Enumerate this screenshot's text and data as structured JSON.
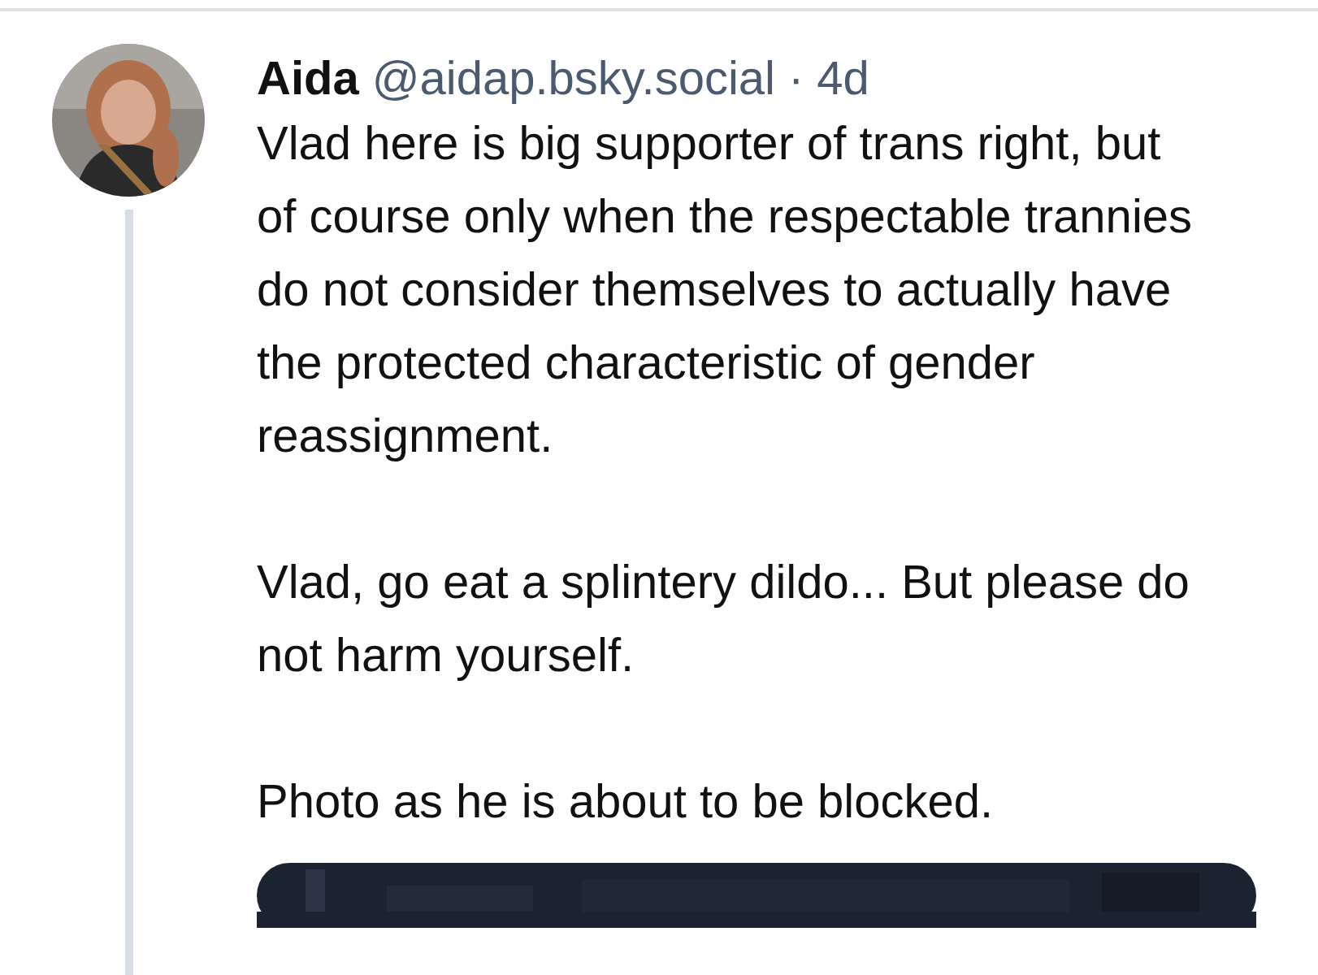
{
  "post": {
    "author": "Aida",
    "handle": "@aidap.bsky.social",
    "separator": "·",
    "time": "4d",
    "paragraphs": [
      "Vlad here is big supporter of trans right, but of course only when the respectable trannies do not consider themselves to actually have the protected characteristic of gender reassignment.",
      "Vlad, go eat a splintery dildo... But please do not harm yourself.",
      "Photo as he is about to be blocked."
    ]
  }
}
